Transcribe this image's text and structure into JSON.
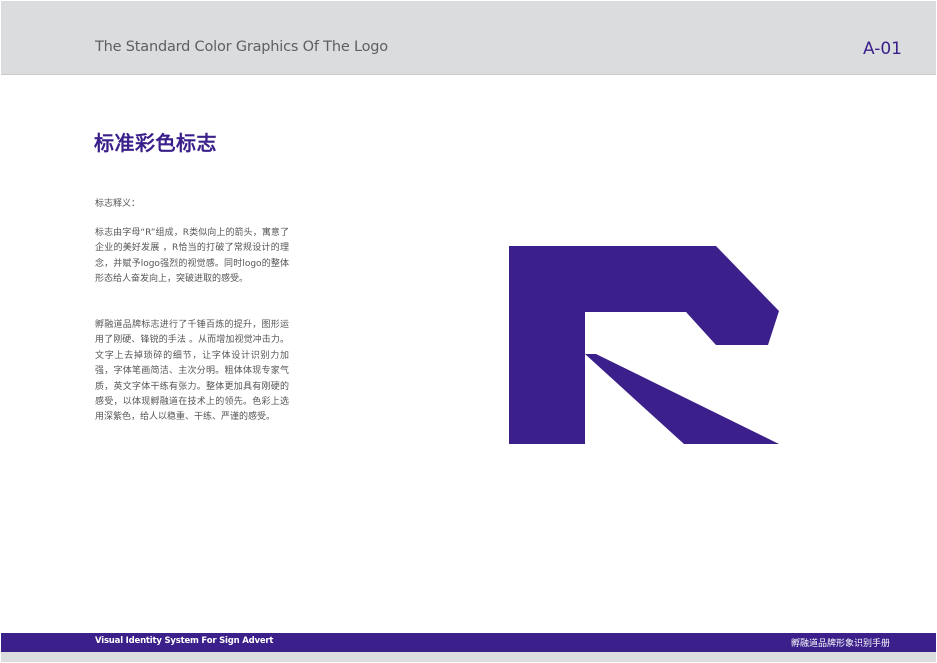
{
  "header": {
    "title": "The Standard Color Graphics Of The Logo",
    "page_code": "A-01"
  },
  "main": {
    "title": "标准彩色标志",
    "description_label": "标志释义：",
    "paragraph_1": "标志由字母“R”组成，R类似向上的箭头，寓意了企业的美好发展 ，R恰当的打破了常规设计的理念，并赋予logo强烈的视觉感。同时logo的整体形态给人奋发向上，突破进取的感受。",
    "paragraph_2": "孵融道品牌标志进行了千锤百炼的提升，图形运用了刚硬、锋锐的手法 。从而增加视觉冲击力。文字上去掉琐碎的细节，让字体设计识别力加强，字体笔画简洁、主次分明。粗体体现专家气质，英文字体干练有张力。整体更加具有刚硬的感受，以体现孵融道在技术上的领先。色彩上选用深紫色，给人以稳重、干练、严谨的感受。"
  },
  "logo": {
    "icon": "r-logo-mark-icon",
    "color": "#3b1f8a"
  },
  "footer": {
    "left_text": "Visual Identity System For Sign Advert",
    "right_text": "孵融道品牌形象识别手册"
  },
  "colors": {
    "brand": "#3b1f8a",
    "header_bg": "#dbdcde",
    "text_gray": "#555555"
  }
}
